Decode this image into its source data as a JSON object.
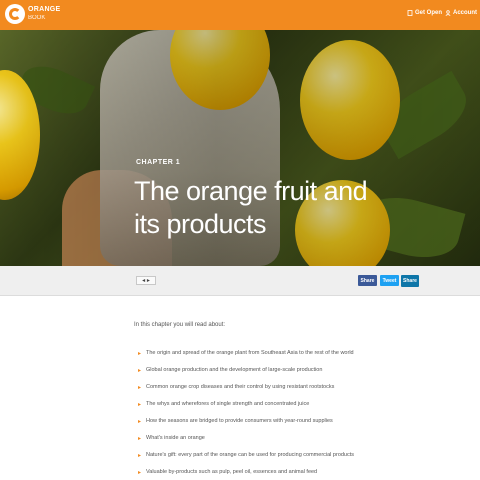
{
  "header": {
    "brand_line1": "ORANGE",
    "brand_line2": "BOOK",
    "get_open": "Get Open",
    "account": "Account"
  },
  "hero": {
    "chapter_label": "CHAPTER 1",
    "title": "The orange fruit and its products"
  },
  "toolbar": {
    "pager": "◂ ▸",
    "share_1": "Share",
    "share_2": "Tweet",
    "share_3": "Share"
  },
  "content": {
    "intro": "In this chapter you will read about:",
    "bullets": [
      "The origin and spread of the orange plant from Southeast Asia to the rest of the world",
      "Global orange production and the development of large-scale production",
      "Common orange crop diseases and their control by using resistant rootstocks",
      "The whys and wherefores of single strength and concentrated juice",
      "How the seasons are bridged to provide consumers with year-round supplies",
      "What's inside an orange",
      "Nature's gift: every part of the orange can be used for producing commercial products",
      "Valuable by-products such as pulp, peel oil, essences and animal feed"
    ]
  },
  "colors": {
    "brand_orange": "#f28a1f"
  }
}
